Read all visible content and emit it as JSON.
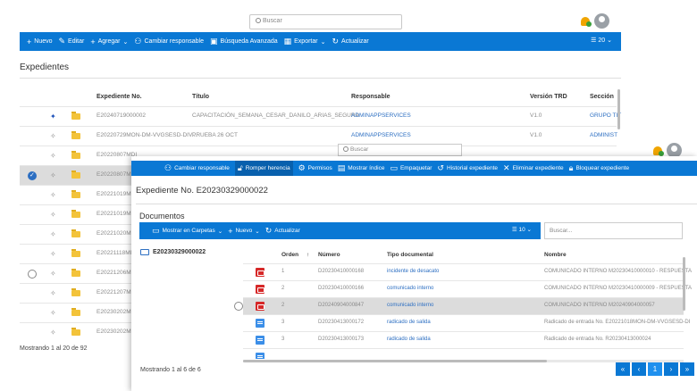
{
  "top_search": {
    "placeholder": "Buscar"
  },
  "toolbar1": {
    "items": [
      "Nuevo",
      "Editar",
      "Agregar",
      "Cambiar responsable",
      "Búsqueda Avanzada",
      "Exportar",
      "Actualizar"
    ],
    "page_size": "20"
  },
  "expedientes": {
    "title": "Expedientes",
    "headers": [
      "Expediente No.",
      "Título",
      "Responsable",
      "Versión TRD",
      "Sección"
    ],
    "rows": [
      {
        "no": "E20240719000002",
        "titulo": "CAPACITACIÓN_SEMANA_CESAR_DANILO_ARIAS_SEGURA",
        "responsable": "ADMINAPPSERVICES",
        "version": "V1.0",
        "seccion": "GRUPO TIT"
      },
      {
        "no": "E20220729MON-DM-VVGSESD-DIV...",
        "titulo": "PRUEBA 26 OCT",
        "responsable": "ADMINAPPSERVICES",
        "version": "V1.0",
        "seccion": "ADMINIST"
      },
      {
        "no": "E20220807MDI"
      },
      {
        "no": "E20220807MDI"
      },
      {
        "no": "E20221019MDI"
      },
      {
        "no": "E20221019MDI"
      },
      {
        "no": "E20221020MDI"
      },
      {
        "no": "E20221118MDI"
      },
      {
        "no": "E20221206MDI"
      },
      {
        "no": "E20221207MDI"
      },
      {
        "no": "E20230202MDI"
      },
      {
        "no": "E20230202MDI"
      }
    ],
    "showing": "Mostrando 1 al 20 de 92"
  },
  "overlay": {
    "search": {
      "placeholder": "Buscar"
    },
    "toolbar": [
      "Cambiar responsable",
      "Romper herencia",
      "Permisos",
      "Mostrar índice",
      "Empaquetar",
      "Historial expediente",
      "Eliminar expediente",
      "Bloquear expediente"
    ],
    "title": "Expediente No. E20230329000022",
    "docs_title": "Documentos",
    "doc_toolbar": [
      "Mostrar en Carpetas",
      "Nuevo",
      "Actualizar"
    ],
    "doc_page_size": "10",
    "doc_search_placeholder": "Buscar...",
    "tree_root": "E20230329000022",
    "headers": [
      "Orden",
      "Número",
      "Tipo documental",
      "Nombre"
    ],
    "rows": [
      {
        "orden": "1",
        "numero": "D20230410000168",
        "tipo": "incidente de desacato",
        "nombre": "COMUNICADO INTERNO M20230410000010 - RESPUESTA",
        "icon": "pdf"
      },
      {
        "orden": "2",
        "numero": "D20230410000166",
        "tipo": "comunicado interno",
        "nombre": "COMUNICADO INTERNO M20230410000009 - RESPUESTA",
        "icon": "pdf"
      },
      {
        "orden": "2",
        "numero": "D20240904000847",
        "tipo": "comunicado interno",
        "nombre": "COMUNICADO INTERNO M20240904000057",
        "icon": "pdf"
      },
      {
        "orden": "3",
        "numero": "D20230413000172",
        "tipo": "radicado de salida",
        "nombre": "Radicado de entrada No. E20221018MON-DM-VVGSESD-DI",
        "icon": "doc"
      },
      {
        "orden": "3",
        "numero": "D20230413000173",
        "tipo": "radicado de salida",
        "nombre": "Radicado de entrada No. R20230413000024",
        "icon": "doc"
      }
    ],
    "showing": "Mostrando 1 al 6 de 6",
    "pager": [
      "«",
      "‹",
      "1",
      "›",
      "»"
    ]
  }
}
